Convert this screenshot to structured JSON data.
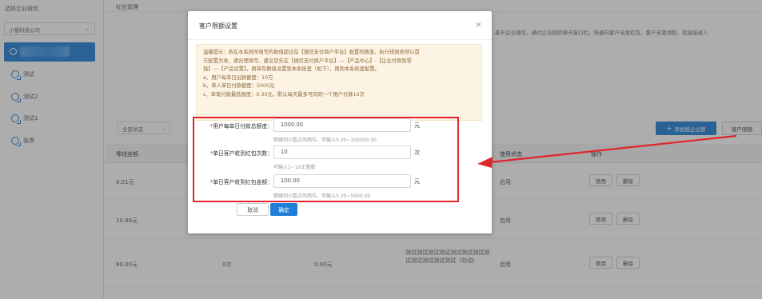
{
  "sidebar": {
    "title": "选择企业微信",
    "company_select": "小猫科技公司",
    "items": [
      {
        "label": "测试"
      },
      {
        "label": "测试2"
      },
      {
        "label": "测试1"
      },
      {
        "label": "张岸"
      }
    ]
  },
  "main": {
    "title": "红包管理",
    "notice_right": "基于企业微信，通过企业微信聊天窗口栏，快速向客户派发红包，客户无需领取，就直接进入",
    "filter": "全部状态",
    "add_button": "添加授企业额",
    "limit_button": "客户限额",
    "headers": {
      "amount": "零钱金额",
      "status": "使用状态",
      "ops": "操作"
    },
    "rows": [
      {
        "amount": "0.01元",
        "status": "启用",
        "op1": "禁用",
        "op2": "删除"
      },
      {
        "amount": "10.88元",
        "status": "启用",
        "op1": "禁用",
        "op2": "删除"
      },
      {
        "amount": "80.00元",
        "c2": "0次",
        "c3": "0.00元",
        "remark": "测试测试测试测试测试测试测试测试测试测试测试测试（勿动）",
        "status": "启用",
        "op1": "禁用",
        "op2": "删除"
      }
    ]
  },
  "dialog": {
    "title": "客户限额设置",
    "close": "×",
    "tip_lines": [
      "温馨提示：若在本系统所填写的数值超过在【微信支付商户平台】配置的数值，执行规则依然以首",
      "方配置为准，请合理填写。建议您先在【微信支付商户平台】---【产品中心】-【企业付款到零",
      "钱】---【产品设置】，再将有数值设置到本系统里（如下），再到本系统里配置。",
      "a、用户每单日出款额度：10万",
      "b、单人单日付款额度：5000元",
      "c、单笔付款最低额度：0.30元，默认每天最多可向同一个用户付款10次"
    ],
    "fields": [
      {
        "label": "用户每单日付款总额度：",
        "value": "1000.00",
        "unit": "元",
        "hint": "精确到小数点后两位，可输入0.30~100000.00"
      },
      {
        "label": "单日客户收到红包次数：",
        "value": "10",
        "unit": "次",
        "hint": "可输入1~10正整数"
      },
      {
        "label": "单日客户收到红包金额：",
        "value": "100.00",
        "unit": "元",
        "hint": "精确到小数点后两位，可输入0.30~5000.00"
      }
    ],
    "cancel": "取消",
    "ok": "确定"
  },
  "colors": {
    "accent": "#1f7fd8",
    "highlight": "#e0262c",
    "tip_bg": "#fdf3e4"
  }
}
